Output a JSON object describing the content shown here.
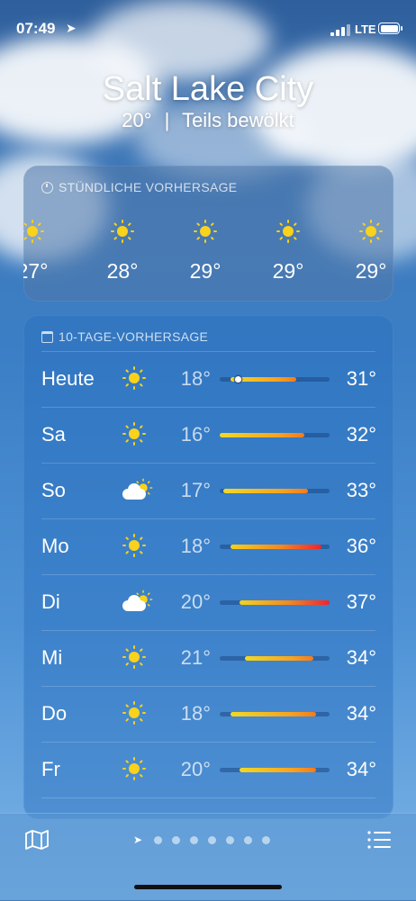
{
  "status": {
    "time": "07:49",
    "network": "LTE"
  },
  "header": {
    "city": "Salt Lake City",
    "temp": "20°",
    "separator": "|",
    "condition": "Teils bewölkt"
  },
  "hourly": {
    "title": "STÜNDLICHE VORHERSAGE",
    "items": [
      {
        "icon": "sun-icon",
        "temp": "27°"
      },
      {
        "icon": "sun-icon",
        "temp": "28°"
      },
      {
        "icon": "sun-icon",
        "temp": "29°"
      },
      {
        "icon": "sun-icon",
        "temp": "29°"
      },
      {
        "icon": "sun-icon",
        "temp": "29°"
      }
    ]
  },
  "daily": {
    "title": "10-TAGE-VORHERSAGE",
    "items": [
      {
        "day": "Heute",
        "icon": "sun-icon",
        "low": "18°",
        "high": "31°",
        "range": [
          0.1,
          0.7
        ],
        "current": 0.16
      },
      {
        "day": "Sa",
        "icon": "sun-icon",
        "low": "16°",
        "high": "32°",
        "range": [
          0.0,
          0.77
        ]
      },
      {
        "day": "So",
        "icon": "partly-cloudy-icon",
        "low": "17°",
        "high": "33°",
        "range": [
          0.03,
          0.8
        ]
      },
      {
        "day": "Mo",
        "icon": "sun-icon",
        "low": "18°",
        "high": "36°",
        "range": [
          0.1,
          0.93
        ]
      },
      {
        "day": "Di",
        "icon": "partly-cloudy-icon",
        "low": "20°",
        "high": "37°",
        "range": [
          0.18,
          1.0
        ]
      },
      {
        "day": "Mi",
        "icon": "sun-icon",
        "low": "21°",
        "high": "34°",
        "range": [
          0.23,
          0.85
        ]
      },
      {
        "day": "Do",
        "icon": "sun-icon",
        "low": "18°",
        "high": "34°",
        "range": [
          0.1,
          0.88
        ]
      },
      {
        "day": "Fr",
        "icon": "sun-icon",
        "low": "20°",
        "high": "34°",
        "range": [
          0.18,
          0.88
        ]
      }
    ]
  },
  "pager": {
    "count": 7
  }
}
